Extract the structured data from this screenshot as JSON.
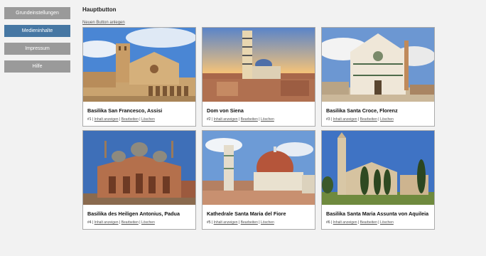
{
  "sidebar": {
    "items": [
      {
        "label": "Grundeinstellungen",
        "active": false
      },
      {
        "label": "Medieninhalte",
        "active": true
      },
      {
        "label": "Impressum",
        "active": false
      },
      {
        "label": "Hilfe",
        "active": false
      }
    ]
  },
  "main": {
    "title": "Hauptbutton",
    "new_button_link": "Neuen Button anlegen"
  },
  "actions": {
    "view": "Inhalt anzeigen",
    "edit": "Bearbeiten",
    "delete": "Löschen",
    "separator": "|"
  },
  "cards": [
    {
      "number": "#1",
      "title": "Basilika San Francesco, Assisi"
    },
    {
      "number": "#2",
      "title": "Dom von Siena"
    },
    {
      "number": "#3",
      "title": "Basilika Santa Croce, Florenz"
    },
    {
      "number": "#4",
      "title": "Basilika des Heiligen Antonius, Padua"
    },
    {
      "number": "#5",
      "title": "Kathedrale Santa Maria del Fiore"
    },
    {
      "number": "#6",
      "title": "Basilika Santa Maria Assunta von Aquileia"
    }
  ],
  "colors": {
    "sidebar_button": "#9a9a9a",
    "sidebar_active": "#4677a3",
    "background": "#f2f2f2"
  }
}
